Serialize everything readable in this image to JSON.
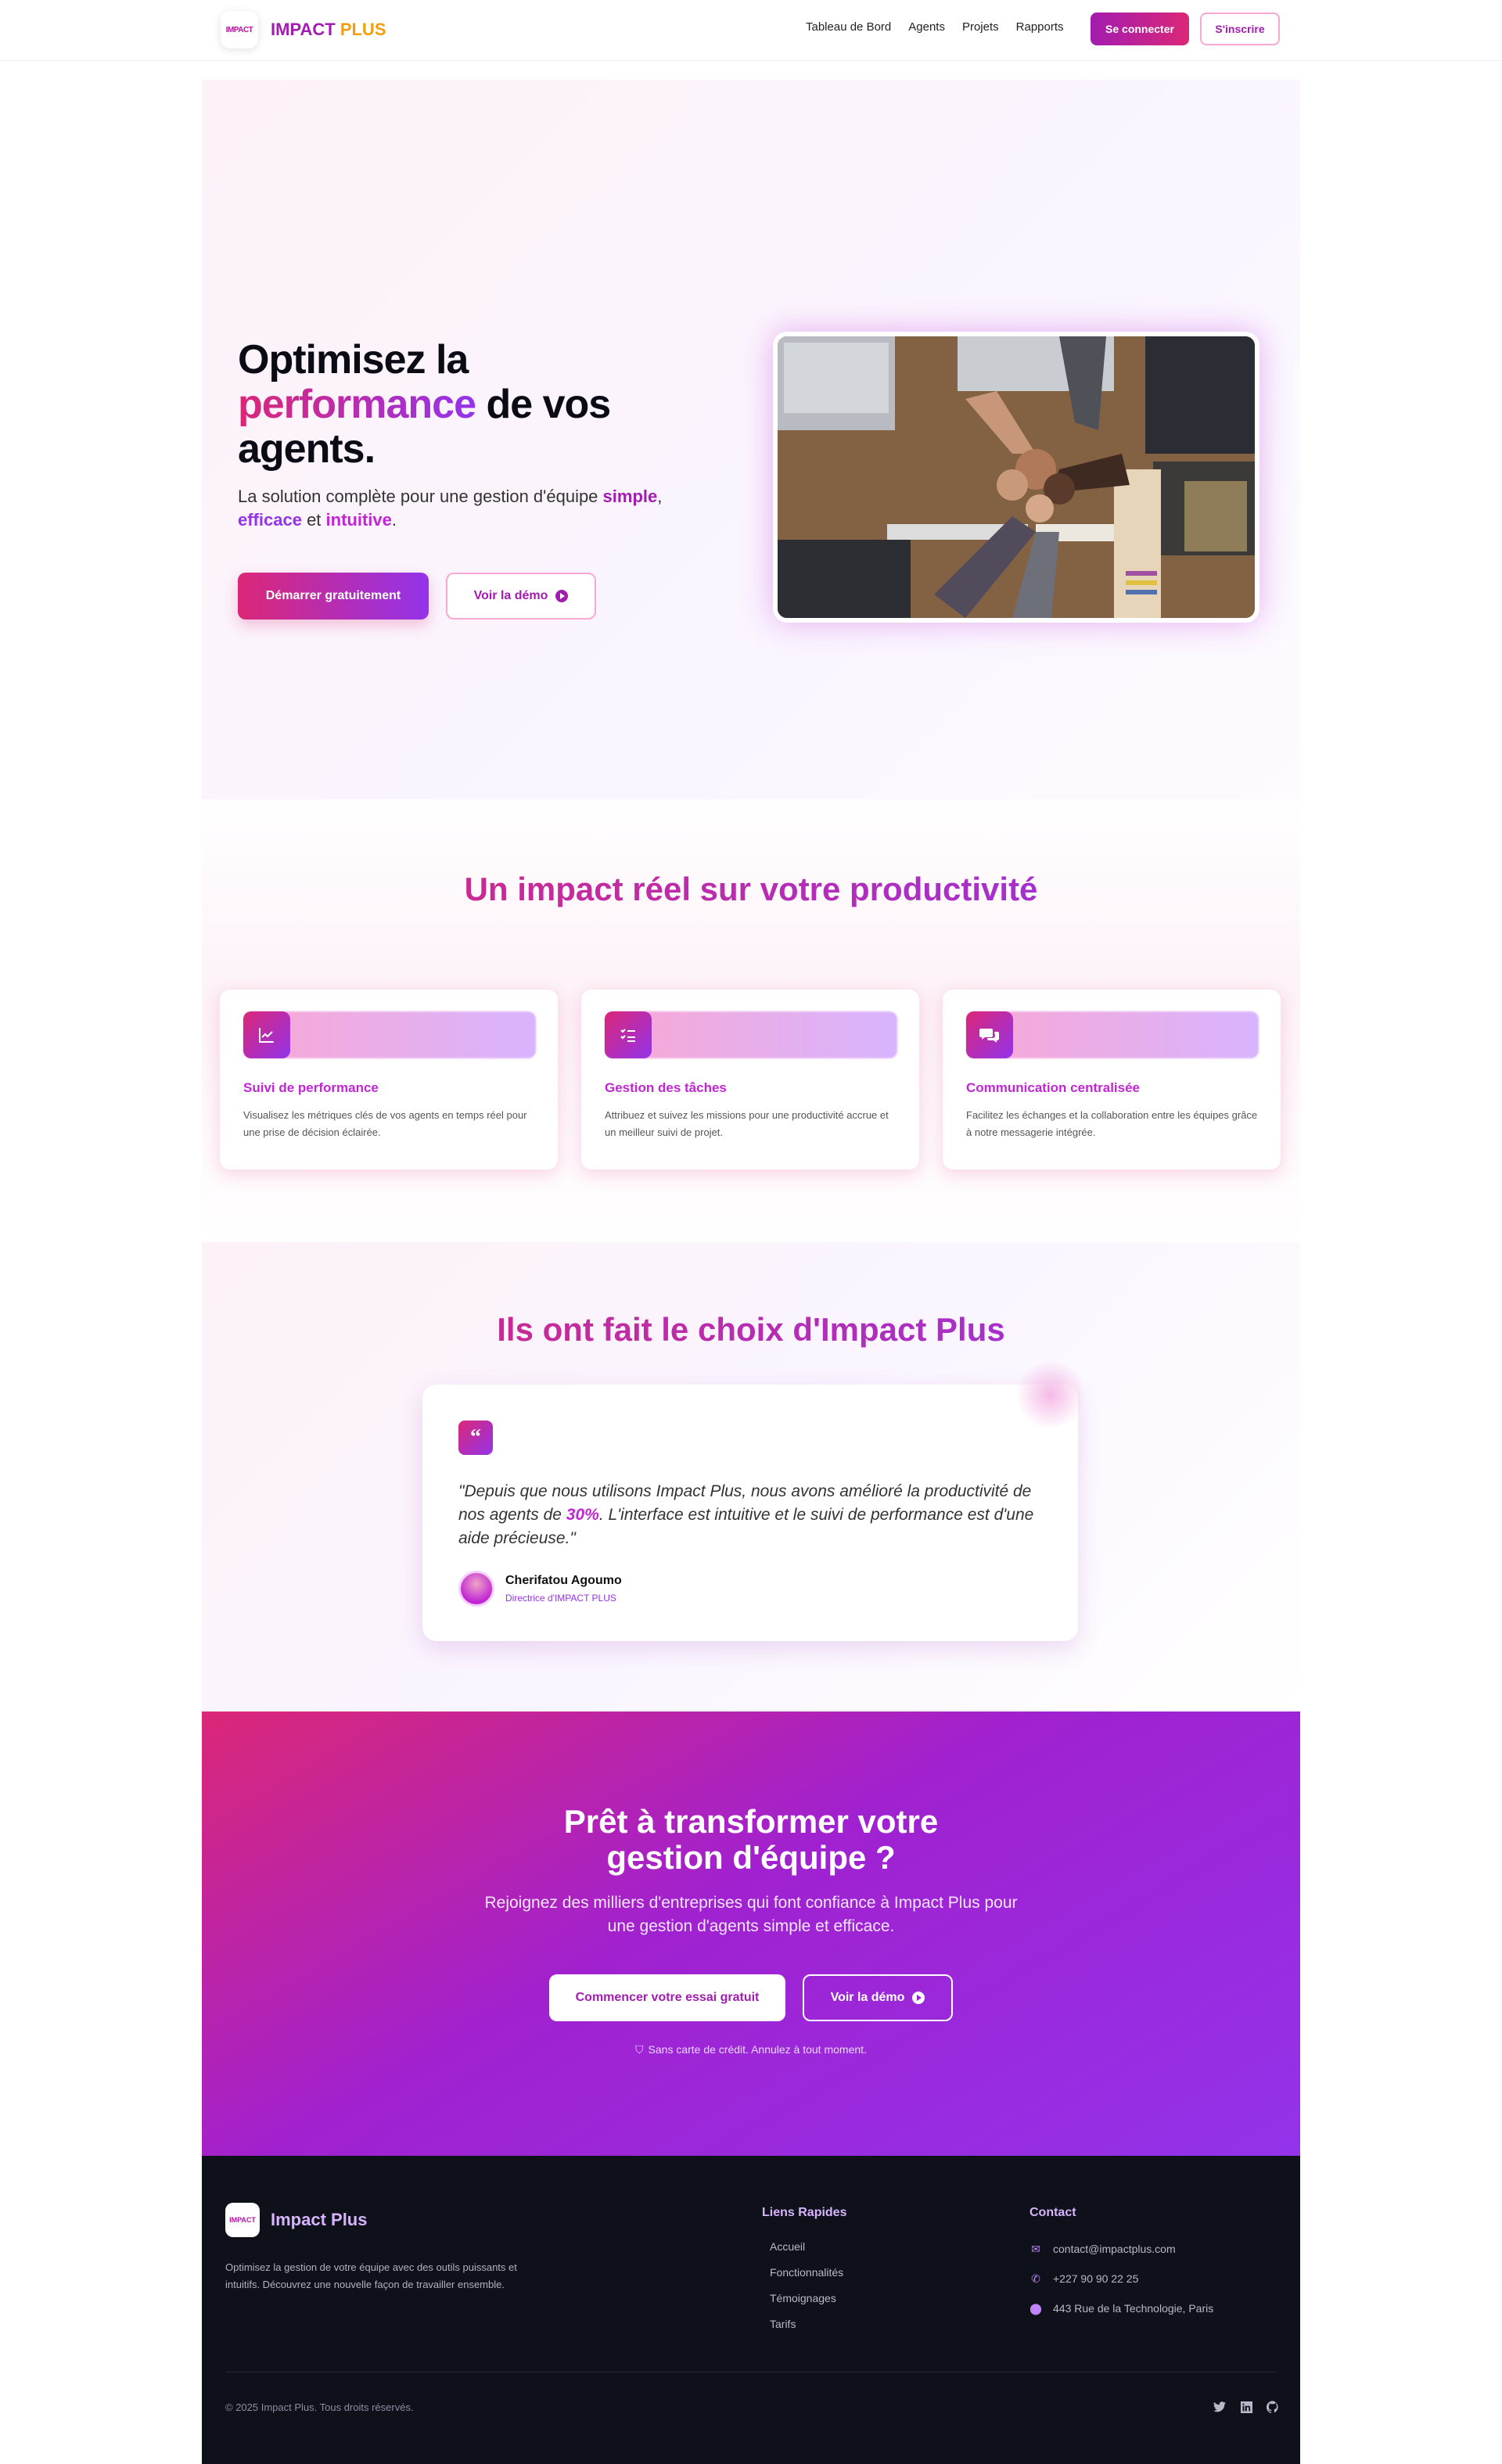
{
  "nav": {
    "logo_text": "IMPACT",
    "brand_main": "IMPACT",
    "brand_plus": " PLUS",
    "links": [
      "Tableau de Bord",
      "Agents",
      "Projets",
      "Rapports"
    ],
    "login_label": "Se connecter",
    "signup_label": "S'inscrire"
  },
  "hero": {
    "title_line1": "Optimisez la",
    "title_highlight": "performance",
    "title_rest": " de vos agents.",
    "subtitle_prefix": "La solution complète pour une gestion d'équipe ",
    "subtitle_w1": "simple",
    "subtitle_sep1": ", ",
    "subtitle_w2": "efficace",
    "subtitle_sep2": " et ",
    "subtitle_w3": "intuitive",
    "subtitle_end": ".",
    "start_label": "Démarrer gratuitement",
    "demo_label": "Voir la démo"
  },
  "features": {
    "title": "Un impact réel sur votre productivité",
    "cards": [
      {
        "title": "Suivi de performance",
        "desc": "Visualisez les métriques clés de vos agents en temps réel pour une prise de décision éclairée.",
        "icon": "chart-line-icon"
      },
      {
        "title": "Gestion des tâches",
        "desc": "Attribuez et suivez les missions pour une productivité accrue et un meilleur suivi de projet.",
        "icon": "task-list-icon"
      },
      {
        "title": "Communication centralisée",
        "desc": "Facilitez les échanges et la collaboration entre les équipes grâce à notre messagerie intégrée.",
        "icon": "chat-bubbles-icon"
      }
    ]
  },
  "testimonial": {
    "title": "Ils ont fait le choix d'Impact Plus",
    "quote_mark": "“",
    "quote_a": "\"Depuis que nous utilisons Impact Plus, nous avons amélioré la productivité de nos agents de ",
    "quote_pct": "30%",
    "quote_b": ". L'interface est intuitive et le suivi de performance est d'une aide précieuse.\"",
    "author": "Cherifatou Agoumo",
    "role": "Directrice d'IMPACT PLUS"
  },
  "cta": {
    "title": "Prêt à transformer votre gestion d'équipe ?",
    "subtitle": "Rejoignez des milliers d'entreprises qui font confiance à Impact Plus pour une gestion d'agents simple et efficace.",
    "trial_label": "Commencer votre essai gratuit",
    "demo_label": "Voir la démo",
    "note": "Sans carte de crédit. Annulez à tout moment."
  },
  "footer": {
    "logo_text": "IMPACT",
    "brand": "Impact Plus",
    "desc": "Optimisez la gestion de votre équipe avec des outils puissants et intuitifs. Découvrez une nouvelle façon de travailler ensemble.",
    "links_heading": "Liens Rapides",
    "links": [
      "Accueil",
      "Fonctionnalités",
      "Témoignages",
      "Tarifs"
    ],
    "contact_heading": "Contact",
    "email": "contact@impactplus.com",
    "phone": "+227 90 90 22 25",
    "address": "443 Rue de la Technologie, Paris",
    "copyright": "© 2025 Impact Plus. Tous droits réservés."
  },
  "colors": {
    "accent_pink": "#db2777",
    "accent_purple": "#9333ea",
    "footer_bg": "#0f111a"
  }
}
